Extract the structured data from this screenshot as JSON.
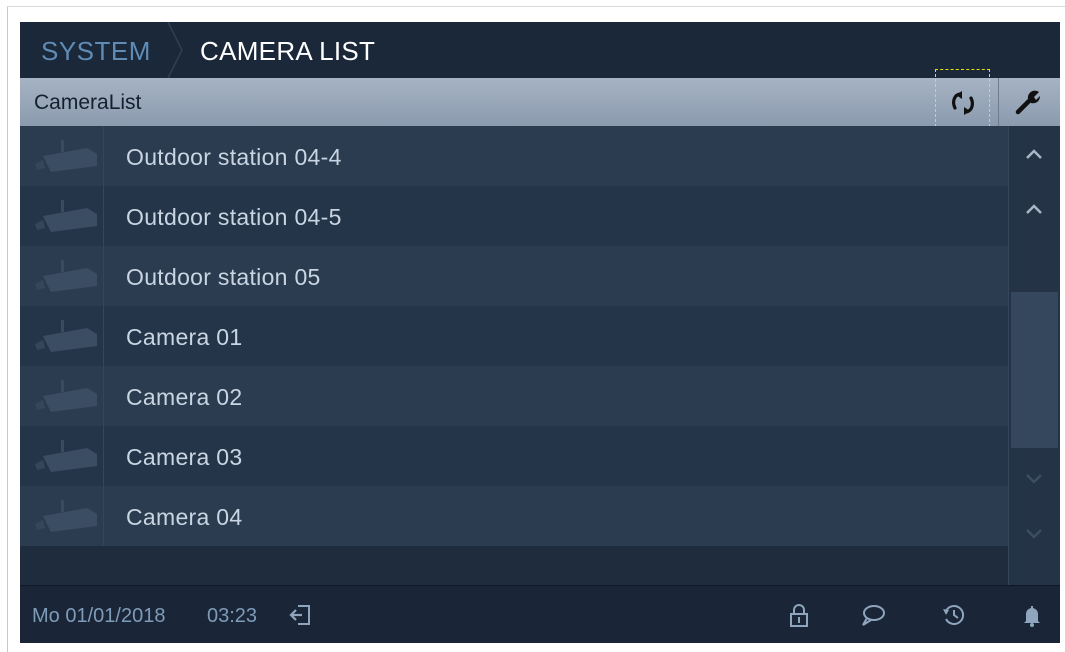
{
  "breadcrumb": {
    "section": "SYSTEM",
    "page": "CAMERA LIST"
  },
  "list_header": {
    "title": "CameraList",
    "refresh_icon": "refresh-icon",
    "settings_icon": "wrench-icon"
  },
  "cameras": [
    {
      "label": "Outdoor station 04-4",
      "icon": "camera-icon"
    },
    {
      "label": "Outdoor station 04-5",
      "icon": "camera-icon"
    },
    {
      "label": "Outdoor station 05",
      "icon": "camera-icon"
    },
    {
      "label": "Camera 01",
      "icon": "camera-icon"
    },
    {
      "label": "Camera 02",
      "icon": "camera-icon"
    },
    {
      "label": "Camera 03",
      "icon": "camera-icon"
    },
    {
      "label": "Camera 04",
      "icon": "camera-icon"
    }
  ],
  "scroll": {
    "up_icons": [
      "chevron-up-icon",
      "chevron-up-icon"
    ],
    "down_icons": [
      "chevron-down-icon",
      "chevron-down-icon"
    ]
  },
  "status_bar": {
    "date": "Mo 01/01/2018",
    "time": "03:23",
    "icons": [
      "logout-icon",
      "lock-icon",
      "message-icon",
      "history-icon",
      "bell-icon"
    ]
  },
  "colors": {
    "accent_blue": "#5f8bb5",
    "header_bar": "#9aa8bb",
    "row_light": "#2b3b50",
    "row_dark": "#24354a",
    "focus_dash": "#e6e100"
  }
}
